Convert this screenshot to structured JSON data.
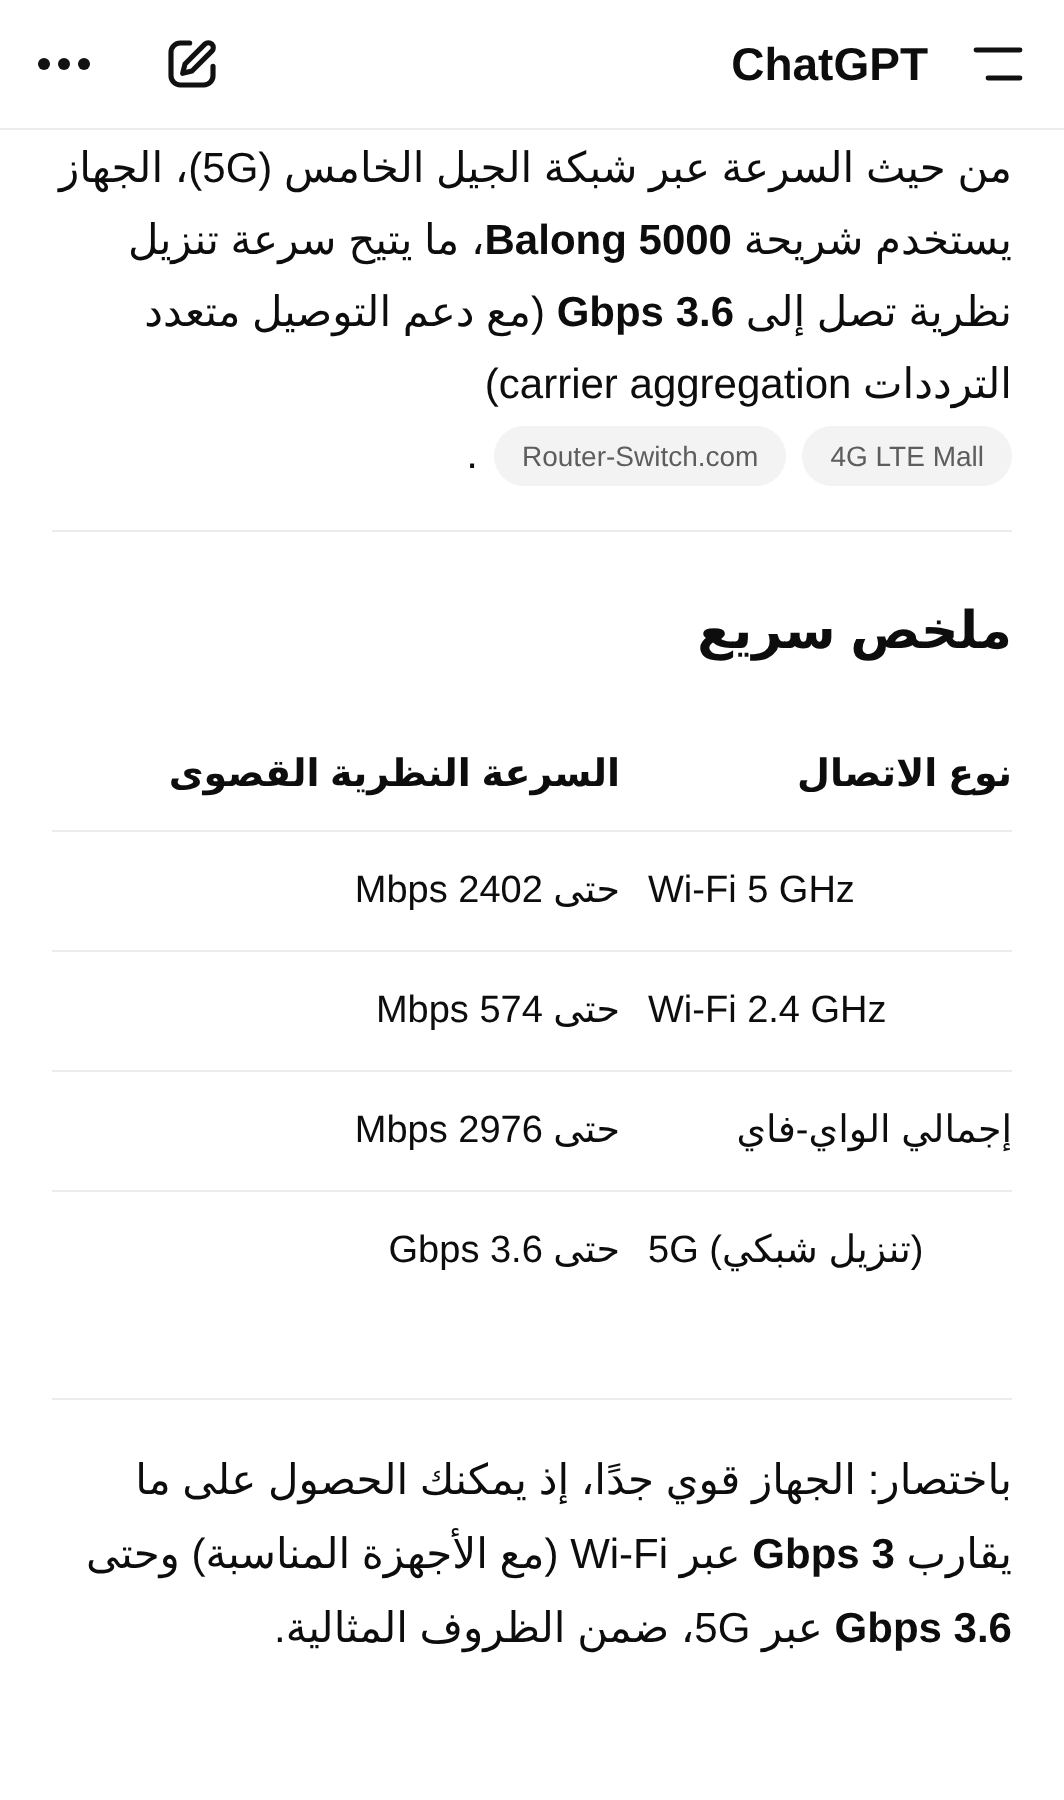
{
  "header": {
    "title": "ChatGPT"
  },
  "intro": {
    "text": "من حيث السرعة عبر شبكة الجيل الخامس (5G)، الجهاز يستخدم شريحة **Balong 5000**، ما يتيح سرعة تنزيل نظرية تصل إلى **3.6 Gbps** (مع دعم التوصيل متعدد الترددات carrier aggregation)",
    "sources": [
      "4G LTE Mall",
      "Router-Switch.com"
    ],
    "end": "."
  },
  "summary": {
    "heading": "ملخص سريع",
    "columns": [
      "نوع الاتصال",
      "السرعة النظرية القصوى"
    ],
    "rows": [
      [
        "Wi-Fi 5 GHz",
        "حتى 2402 Mbps"
      ],
      [
        "Wi-Fi 2.4 GHz",
        "حتى 574 Mbps"
      ],
      [
        "إجمالي الواي-فاي",
        "حتى 2976 Mbps"
      ],
      [
        "5G (تنزيل شبكي)",
        "حتى 3.6 Gbps"
      ]
    ]
  },
  "conclusion": "باختصار: الجهاز قوي جدًا، إذ يمكنك الحصول على ما يقارب **3 Gbps** عبر Wi-Fi (مع الأجهزة المناسبة) وحتى **3.6 Gbps** عبر 5G، ضمن الظروف المثالية."
}
